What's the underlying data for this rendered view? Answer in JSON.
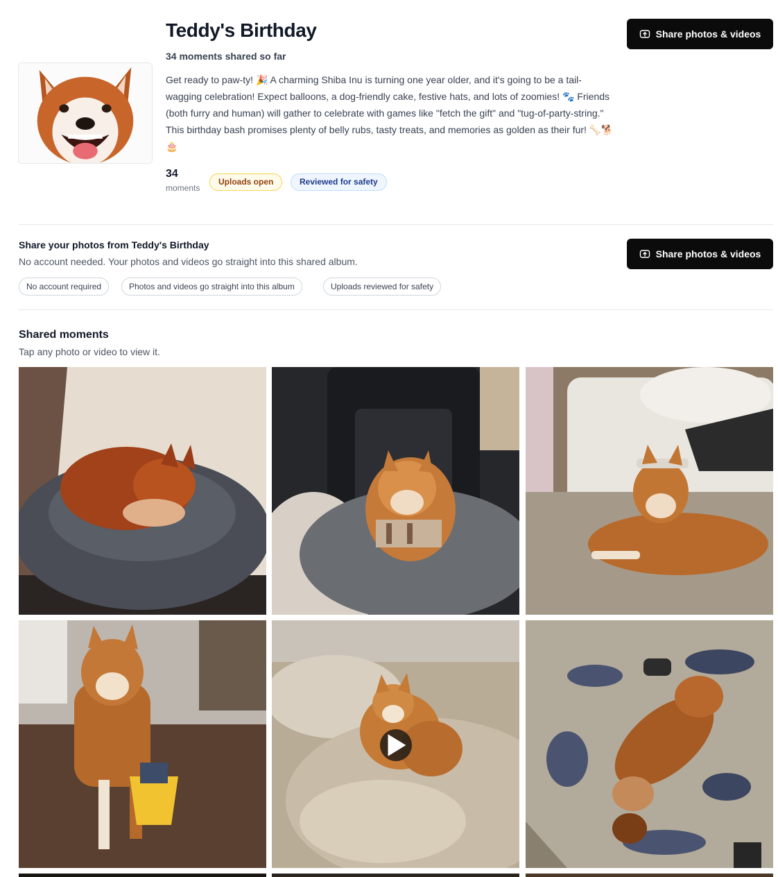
{
  "album": {
    "title": "Teddy's Birthday",
    "subtitle": "34 moments shared so far",
    "description": "Get ready to paw-ty! 🎉 A charming Shiba Inu is turning one year older, and it's going to be a tail-wagging celebration! Expect balloons, a dog-friendly cake, festive hats, and lots of zoomies! 🐾 Friends (both furry and human) will gather to celebrate with games like \"fetch the gift\" and \"tug-of-party-string.\" This birthday bash promises plenty of belly rubs, tasty treats, and memories as golden as their fur! 🦴🐕🎂",
    "moment_count": "34",
    "moment_count_label": "moments",
    "badges": {
      "uploads": "Uploads open",
      "safety": "Reviewed for safety"
    },
    "share_button_label": "Share photos & videos",
    "share_icon": "upload-cloud-icon"
  },
  "share_section": {
    "title": "Share your photos from Teddy's Birthday",
    "subtitle": "No account needed. Your photos and videos go straight into this shared album.",
    "button_label": "Share photos & videos",
    "pills": [
      "No account required",
      "Photos and videos go straight into this album",
      "Uploads reviewed for safety"
    ]
  },
  "moments": {
    "title": "Shared moments",
    "subtitle": "Tap any photo or video to view it.",
    "items": [
      {
        "type": "photo",
        "scene": "dog curled in grey bed"
      },
      {
        "type": "photo",
        "scene": "dog in car seat wearing plaid bandana"
      },
      {
        "type": "photo",
        "scene": "dog lying on rug with headband"
      },
      {
        "type": "photo",
        "scene": "dog standing with yellow toy bucket"
      },
      {
        "type": "video",
        "scene": "dog on beige blankets",
        "play_icon": "play-icon"
      },
      {
        "type": "photo",
        "scene": "dog rolling on patterned rug"
      }
    ]
  },
  "colors": {
    "button_bg": "#0b0b0c",
    "badge_open_bg": "#fffbeb",
    "badge_open_text": "#92400e",
    "badge_safe_bg": "#eff6ff",
    "badge_safe_text": "#1e3a8a"
  }
}
